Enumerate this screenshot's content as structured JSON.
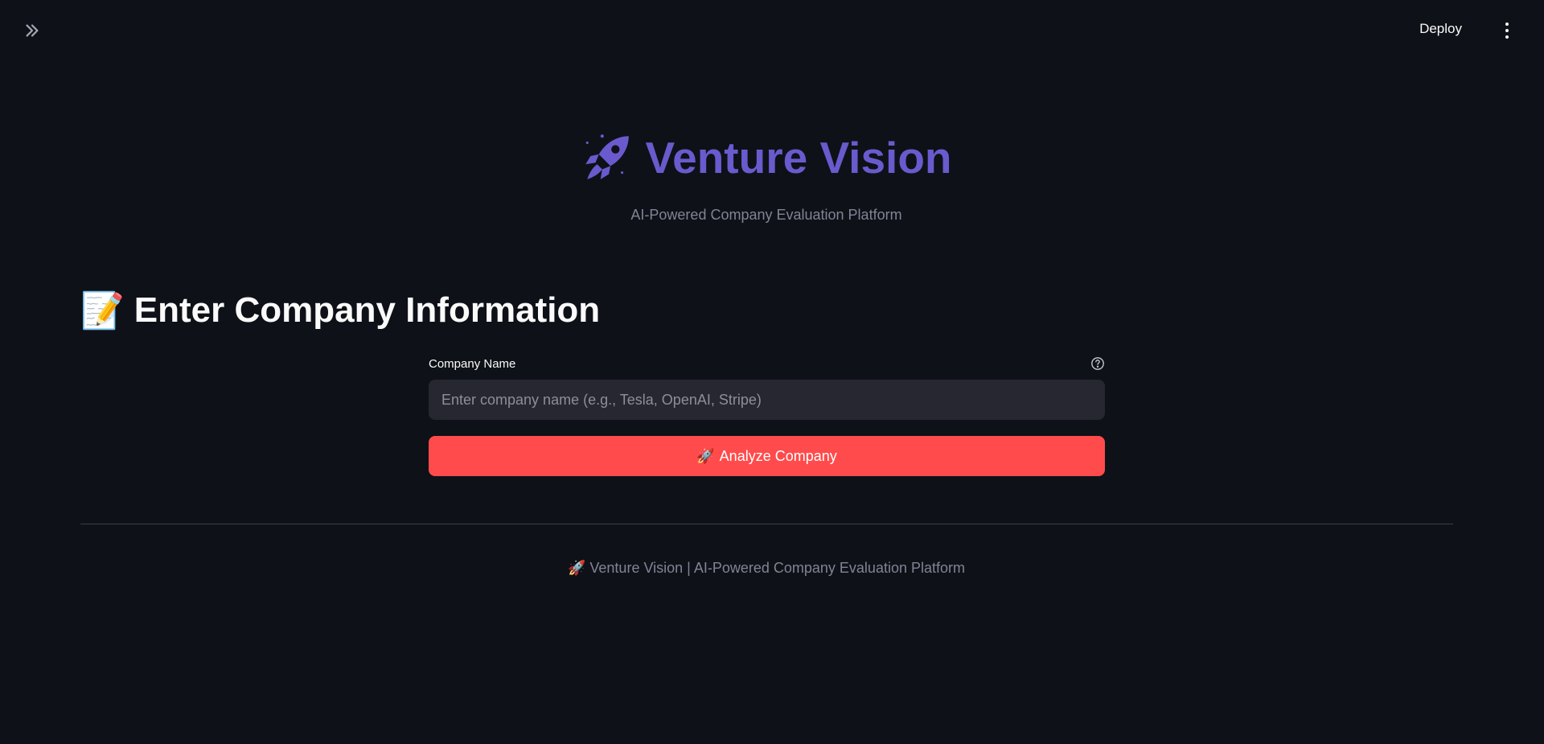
{
  "header": {
    "expand_icon": "chevrons-right-icon",
    "deploy_label": "Deploy",
    "menu_icon": "kebab-menu-icon"
  },
  "hero": {
    "icon": "🚀",
    "title": "Venture Vision",
    "subtitle": "AI-Powered Company Evaluation Platform",
    "title_color": "#6a5acd"
  },
  "section": {
    "icon": "📝",
    "heading": "Enter Company Information"
  },
  "form": {
    "company_label": "Company Name",
    "company_placeholder": "Enter company name (e.g., Tesla, OpenAI, Stripe)",
    "company_value": "",
    "help_icon": "question-circle-icon",
    "analyze_icon": "🚀",
    "analyze_label": "Analyze Company",
    "button_color": "#ff4b4b"
  },
  "footer": {
    "text": "🚀 Venture Vision | AI-Powered Company Evaluation Platform"
  }
}
